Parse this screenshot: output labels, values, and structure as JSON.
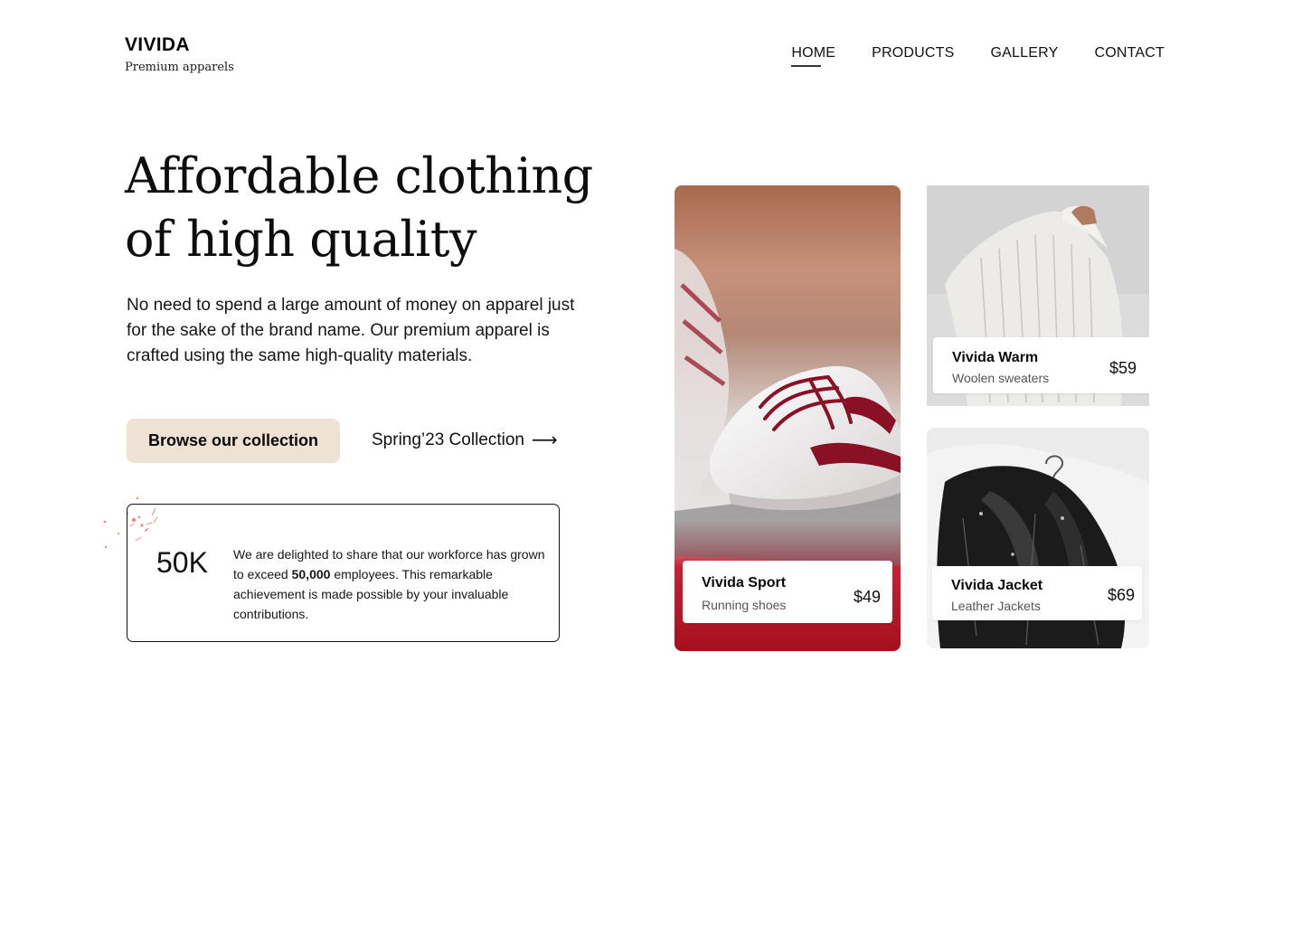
{
  "brand": {
    "name": "VIVIDA",
    "tagline": "Premium apparels"
  },
  "nav": {
    "items": [
      {
        "label": "HOME",
        "active": true
      },
      {
        "label": "PRODUCTS",
        "active": false
      },
      {
        "label": "GALLERY",
        "active": false
      },
      {
        "label": "CONTACT",
        "active": false
      }
    ]
  },
  "hero": {
    "title_line1": "Affordable clothing",
    "title_line2": "of high quality",
    "description": "No need to spend a large amount of money on apparel just for the sake of the brand name. Our premium apparel is crafted using the same high-quality materials.",
    "cta_label": "Browse our collection",
    "secondary_link": "Spring’23 Collection",
    "secondary_icon": "arrow-right-icon"
  },
  "stat": {
    "number": "50K",
    "text_before": "We are delighted to share that our workforce has grown to exceed ",
    "text_bold": "50,000",
    "text_after": " employees. This remarkable achievement is made possible by your invaluable contributions."
  },
  "products": [
    {
      "name": "Vivida Sport",
      "category": "Running shoes",
      "price": "$49",
      "image": "white-red-sneaker"
    },
    {
      "name": "Vivida Warm",
      "category": "Woolen sweaters",
      "price": "$59",
      "image": "knit-sweater"
    },
    {
      "name": "Vivida Jacket",
      "category": "Leather Jackets",
      "price": "$69",
      "image": "black-leather-jacket"
    }
  ],
  "colors": {
    "cta_background": "#efe1d3",
    "text": "#111111",
    "sneaker_accent": "#8a1026"
  }
}
